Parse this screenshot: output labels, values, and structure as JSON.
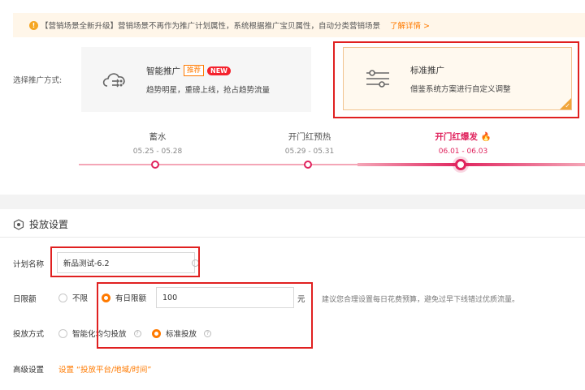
{
  "notice": {
    "text": "【营销场景全新升级】营销场景不再作为推广计划属性，系统根据推广宝贝属性，自动分类营销场景",
    "link": "了解详情 >",
    "icon": "exclamation-icon"
  },
  "mode": {
    "label": "选择推广方式:",
    "smart": {
      "title": "智能推广",
      "tag_recommend": "推荐",
      "tag_new": "NEW",
      "sub": "趋势明星，重磅上线，抢占趋势流量",
      "icon": "cloud-flow-icon"
    },
    "standard": {
      "title": "标准推广",
      "sub": "借鉴系统方案进行自定义调整",
      "icon": "sliders-icon",
      "selected": true
    }
  },
  "timeline": {
    "stages": [
      {
        "name": "蓄水",
        "date": "05.25 - 05.28"
      },
      {
        "name": "开门红预热",
        "date": "05.29 - 05.31"
      },
      {
        "name": "开门红爆发",
        "date": "06.01 - 06.03",
        "active": true
      }
    ]
  },
  "settings": {
    "title": "投放设置",
    "plan_name": {
      "label": "计划名称",
      "value": "新品测试-6.2"
    },
    "daily_limit": {
      "label": "日限额",
      "option_none": "不限",
      "option_daily": "有日限额",
      "selected": "有日限额",
      "amount": "100",
      "unit": "元",
      "hint": "建议您合理设置每日花费预算，避免过早下线错过优质流量。"
    },
    "delivery": {
      "label": "投放方式",
      "option_smart": "智能化均匀投放",
      "option_standard": "标准投放",
      "selected": "标准投放"
    },
    "advanced": {
      "label": "高级设置",
      "link": "设置 “投放平台/地域/时间”"
    }
  },
  "colors": {
    "accent": "#ff7a00",
    "highlight": "#e02020",
    "timeline": "#e0245e"
  }
}
